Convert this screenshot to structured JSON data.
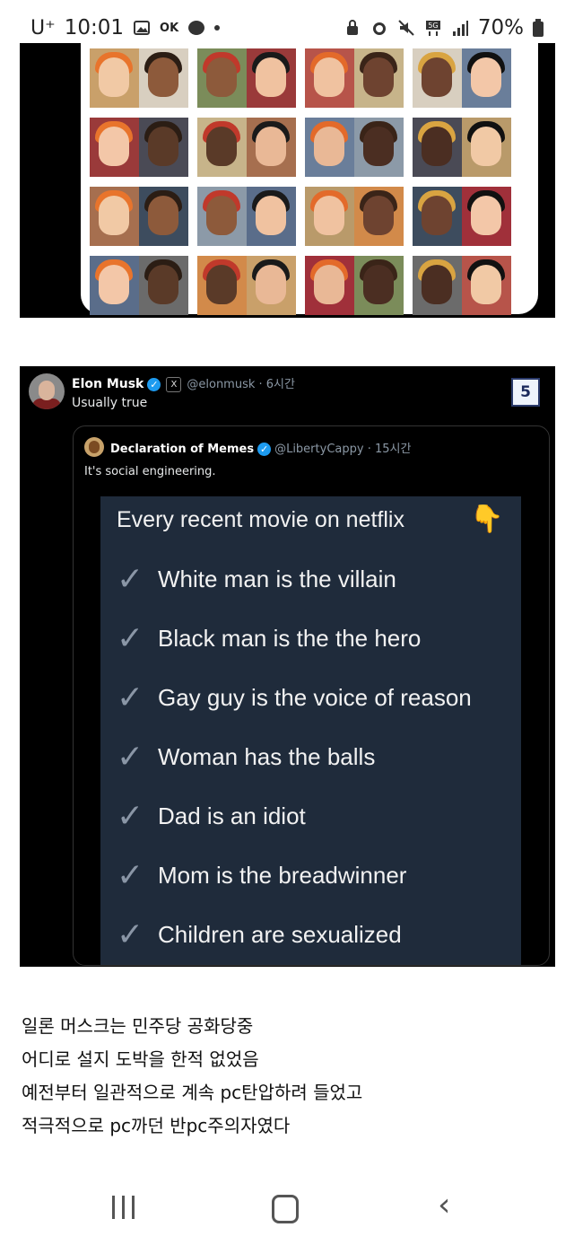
{
  "status_bar": {
    "carrier": "U⁺",
    "time": "10:01",
    "left_icons": [
      "gallery-icon",
      "ok-icon",
      "messenger-icon"
    ],
    "right_icons": [
      "lock-icon",
      "alarm-icon",
      "mute-icon",
      "5g-icon",
      "signal-icon"
    ],
    "battery": "70%",
    "ok_label": "OK"
  },
  "tweet": {
    "author_name": "Elon Musk",
    "author_handle": "@elonmusk · 6시간",
    "text": "Usually true",
    "page_number": "5",
    "quote": {
      "author_name": "Declaration of Memes",
      "author_handle": "@LibertyCappy · 15시간",
      "text": "It's social engineering.",
      "meme": {
        "title": "Every recent movie on netflix",
        "items": [
          "White man is the villain",
          "Black man is the the hero",
          "Gay guy is the voice of reason",
          "Woman has the balls",
          "Dad is an idiot",
          "Mom is the breadwinner",
          "Children are sexualized"
        ]
      }
    }
  },
  "caption": {
    "lines": [
      "일론 머스크는 민주당 공화당중",
      "어디로 설지 도박을 한적 없었음",
      "예전부터 일관적으로 계속 pc탄압하려 들었고",
      "적극적으로 pc까던 반pc주의자였다"
    ]
  },
  "colors": {
    "meme_background": "#1f2b3b",
    "verified_blue": "#1d9bf0",
    "page_badge_border": "#2a3a6a"
  }
}
